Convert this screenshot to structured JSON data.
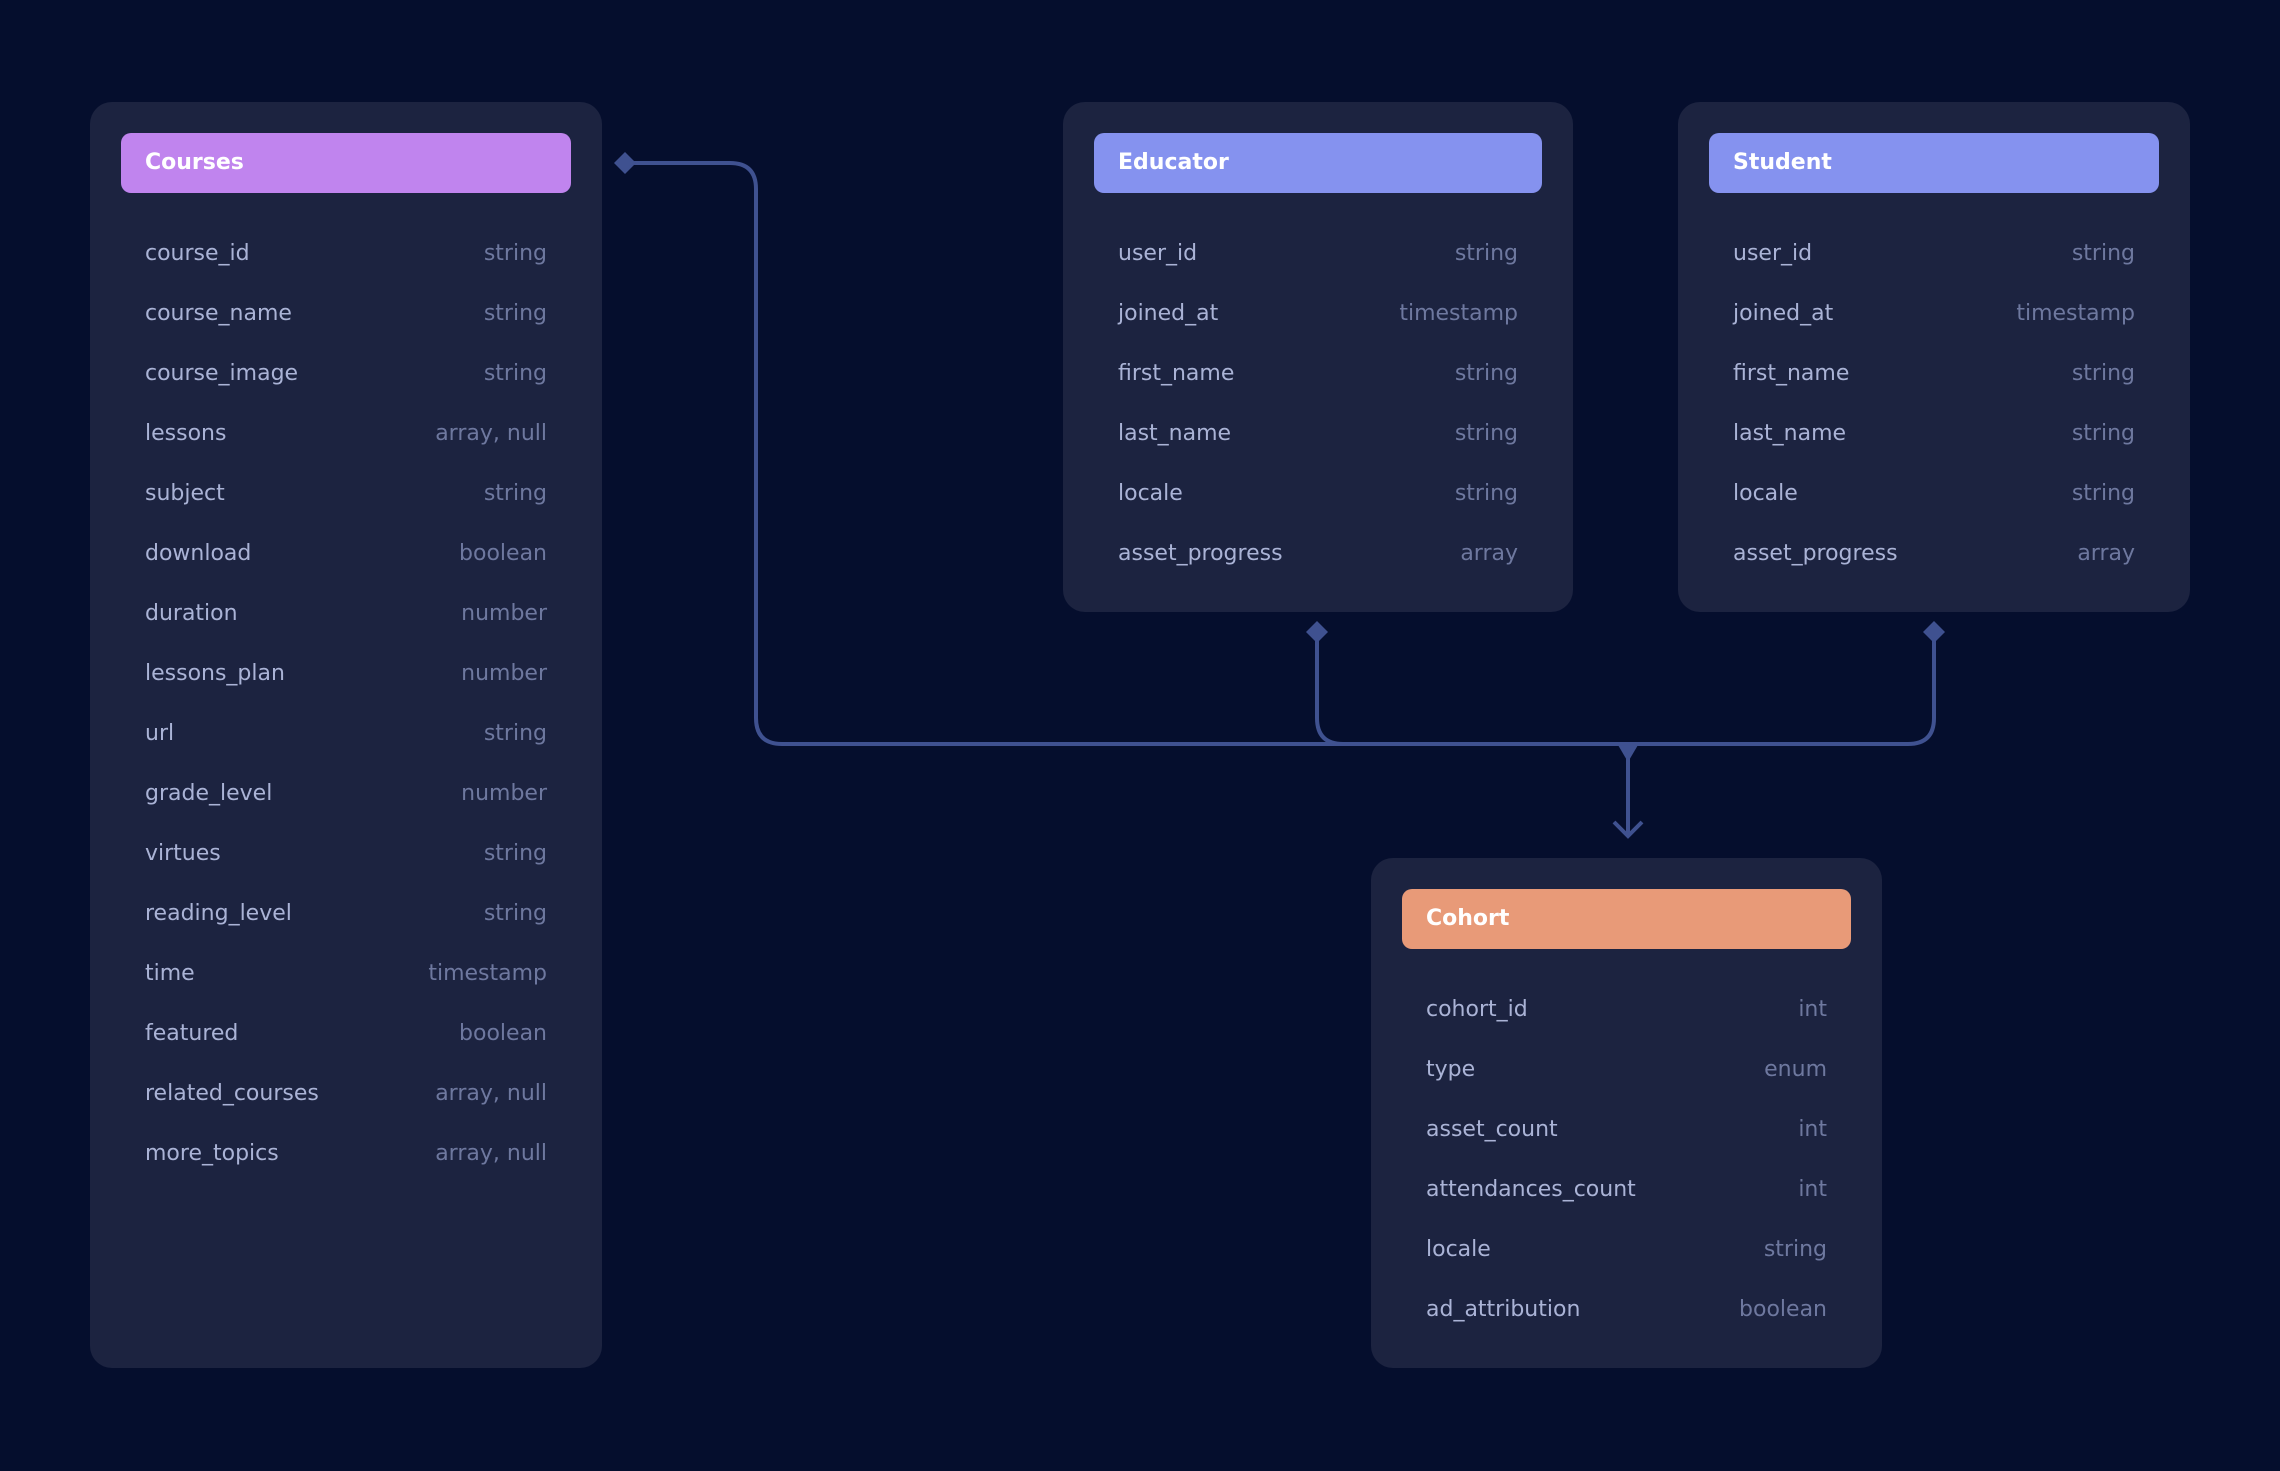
{
  "colors": {
    "background": "#050e2d",
    "card": "#1c2340",
    "connector": "#3f5190",
    "courses": "#c084ee",
    "educator": "#8592ef",
    "student": "#8592ef",
    "cohort": "#e89a78"
  },
  "tables": {
    "courses": {
      "title": "Courses",
      "fields": [
        {
          "name": "course_id",
          "type": "string"
        },
        {
          "name": "course_name",
          "type": "string"
        },
        {
          "name": "course_image",
          "type": "string"
        },
        {
          "name": "lessons",
          "type": "array, null"
        },
        {
          "name": "subject",
          "type": "string"
        },
        {
          "name": "download",
          "type": "boolean"
        },
        {
          "name": "duration",
          "type": "number"
        },
        {
          "name": "lessons_plan",
          "type": "number"
        },
        {
          "name": "url",
          "type": "string"
        },
        {
          "name": "grade_level",
          "type": "number"
        },
        {
          "name": "virtues",
          "type": "string"
        },
        {
          "name": "reading_level",
          "type": "string"
        },
        {
          "name": "time",
          "type": "timestamp"
        },
        {
          "name": "featured",
          "type": "boolean"
        },
        {
          "name": "related_courses",
          "type": "array, null"
        },
        {
          "name": "more_topics",
          "type": "array, null"
        }
      ]
    },
    "educator": {
      "title": "Educator",
      "fields": [
        {
          "name": "user_id",
          "type": "string"
        },
        {
          "name": "joined_at",
          "type": "timestamp"
        },
        {
          "name": "first_name",
          "type": "string"
        },
        {
          "name": "last_name",
          "type": "string"
        },
        {
          "name": "locale",
          "type": "string"
        },
        {
          "name": "asset_progress",
          "type": "array"
        }
      ]
    },
    "student": {
      "title": "Student",
      "fields": [
        {
          "name": "user_id",
          "type": "string"
        },
        {
          "name": "joined_at",
          "type": "timestamp"
        },
        {
          "name": "first_name",
          "type": "string"
        },
        {
          "name": "last_name",
          "type": "string"
        },
        {
          "name": "locale",
          "type": "string"
        },
        {
          "name": "asset_progress",
          "type": "array"
        }
      ]
    },
    "cohort": {
      "title": "Cohort",
      "fields": [
        {
          "name": "cohort_id",
          "type": "int"
        },
        {
          "name": "type",
          "type": "enum"
        },
        {
          "name": "asset_count",
          "type": "int"
        },
        {
          "name": "attendances_count",
          "type": "int"
        },
        {
          "name": "locale",
          "type": "string"
        },
        {
          "name": "ad_attribution",
          "type": "boolean"
        }
      ]
    }
  }
}
